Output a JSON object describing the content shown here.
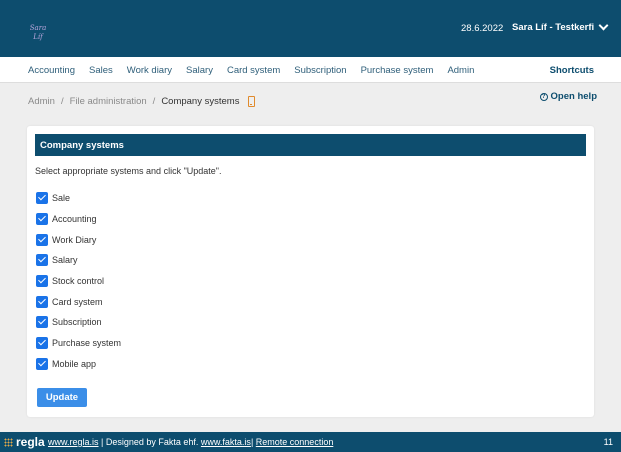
{
  "header": {
    "logo_line1": "Sara",
    "logo_line2": "Líf",
    "date": "28.6.2022",
    "user": "Sara Líf - Testkerfi"
  },
  "nav": {
    "items": [
      "Accounting",
      "Sales",
      "Work diary",
      "Salary",
      "Card system",
      "Subscription",
      "Purchase system",
      "Admin"
    ],
    "shortcuts": "Shortcuts"
  },
  "breadcrumb": {
    "items": [
      "Admin",
      "File administration"
    ],
    "separator": "/",
    "current": "Company systems"
  },
  "help": {
    "label": "Open help",
    "icon": "question-circle-icon"
  },
  "card": {
    "title": "Company systems",
    "intro": "Select appropriate systems and click \"Update\".",
    "systems": [
      {
        "label": "Sale",
        "checked": true
      },
      {
        "label": "Accounting",
        "checked": true
      },
      {
        "label": "Work Diary",
        "checked": true
      },
      {
        "label": "Salary",
        "checked": true
      },
      {
        "label": "Stock control",
        "checked": true
      },
      {
        "label": "Card system",
        "checked": true
      },
      {
        "label": "Subscription",
        "checked": true
      },
      {
        "label": "Purchase system",
        "checked": true
      },
      {
        "label": "Mobile app",
        "checked": true
      }
    ],
    "update_label": "Update"
  },
  "footer": {
    "brand": "regla",
    "link1": "www.regla.is",
    "text1": " | Designed by Fakta ehf. ",
    "link2": "www.fakta.is",
    "text2": "| ",
    "link3": "Remote connection",
    "number": "11"
  },
  "colors": {
    "primary": "#0d4d6e",
    "checkbox": "#1a73e8",
    "button": "#3b8ee8",
    "accent_icon": "#e08a2c"
  }
}
